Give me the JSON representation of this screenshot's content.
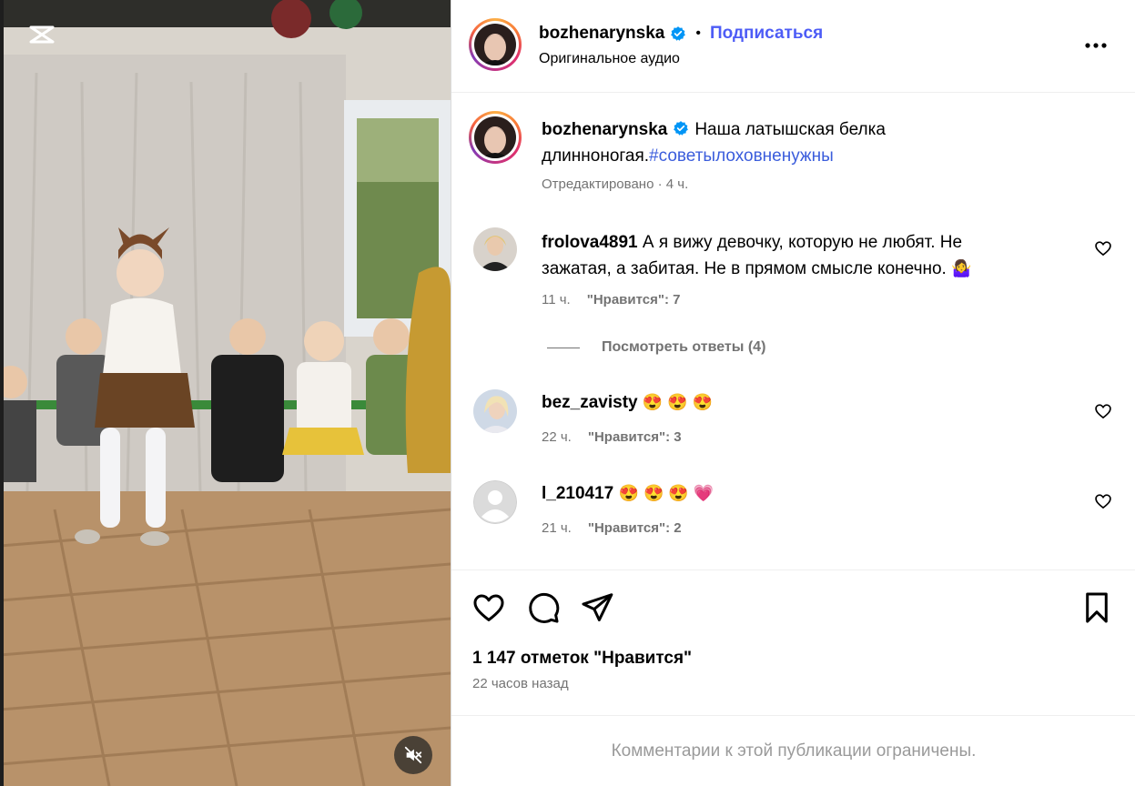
{
  "post": {
    "username": "bozhenarynska",
    "follow_label": "Подписаться",
    "dot": "•",
    "audio_label": "Оригинальное аудио"
  },
  "caption": {
    "username": "bozhenarynska",
    "text": "Наша латышская белка длинноногая.",
    "hashtag": "#советылоховненужны",
    "meta": "Отредактировано · 4 ч."
  },
  "comments": [
    {
      "username": "frolova4891",
      "text": "А я вижу девочку, которую не любят. Не зажатая, а забитая. Не в прямом смысле конечно.",
      "emoji": "🤷‍♀️",
      "time": "11 ч.",
      "likes": "\"Нравится\": 7"
    },
    {
      "username": "bez_zavisty",
      "text": "",
      "emoji": "😍 😍 😍",
      "time": "22 ч.",
      "likes": "\"Нравится\": 3"
    },
    {
      "username": "l_210417",
      "text": "",
      "emoji": "😍 😍 😍 💗",
      "time": "21 ч.",
      "likes": "\"Нравится\": 2"
    }
  ],
  "view_replies": "Посмотреть ответы (4)",
  "footer": {
    "likes_count": "1 147 отметок \"Нравится\"",
    "time_ago": "22 часов назад",
    "comments_limited": "Комментарии к этой публикации ограничены."
  },
  "icons": {
    "more": "more-horizontal-icon",
    "like": "heart-icon",
    "comment": "comment-icon",
    "share": "send-icon",
    "save": "bookmark-icon",
    "mute": "muted-speaker-icon",
    "verified": "verified-badge-icon"
  },
  "colors": {
    "link": "#4d5cf6",
    "hashtag": "#3b5ddc",
    "secondary_text": "#737373",
    "verified": "#0095f6"
  }
}
